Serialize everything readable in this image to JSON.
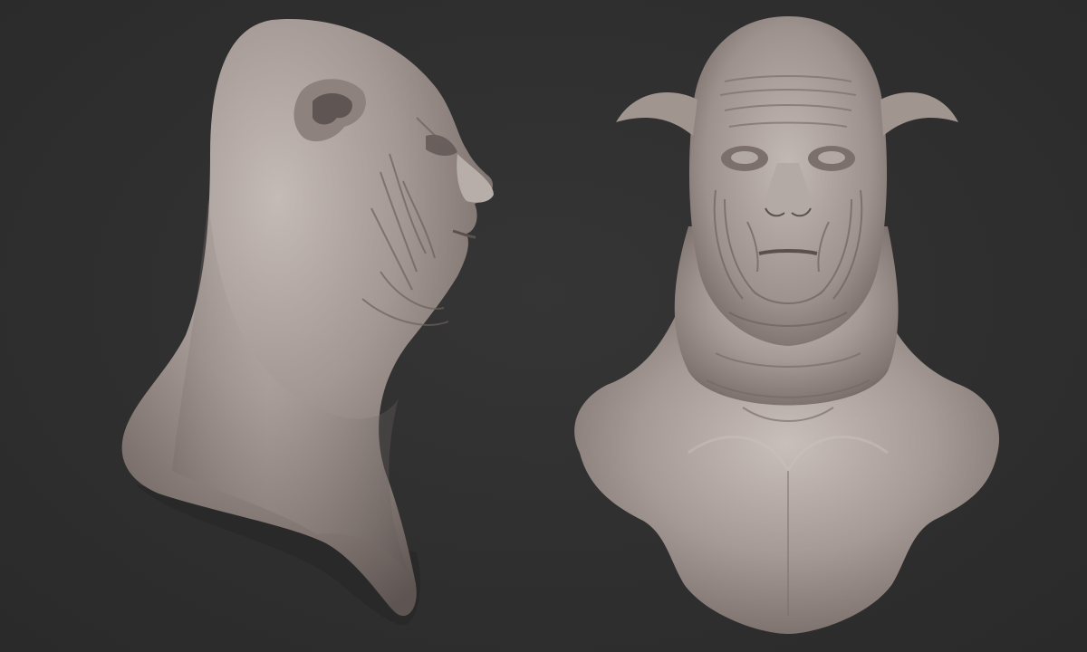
{
  "viewport": {
    "background_color": "#2f2f2f"
  },
  "models": [
    {
      "view": "side profile",
      "material_color": "#a39894"
    },
    {
      "view": "front",
      "material_color": "#a39894"
    }
  ]
}
